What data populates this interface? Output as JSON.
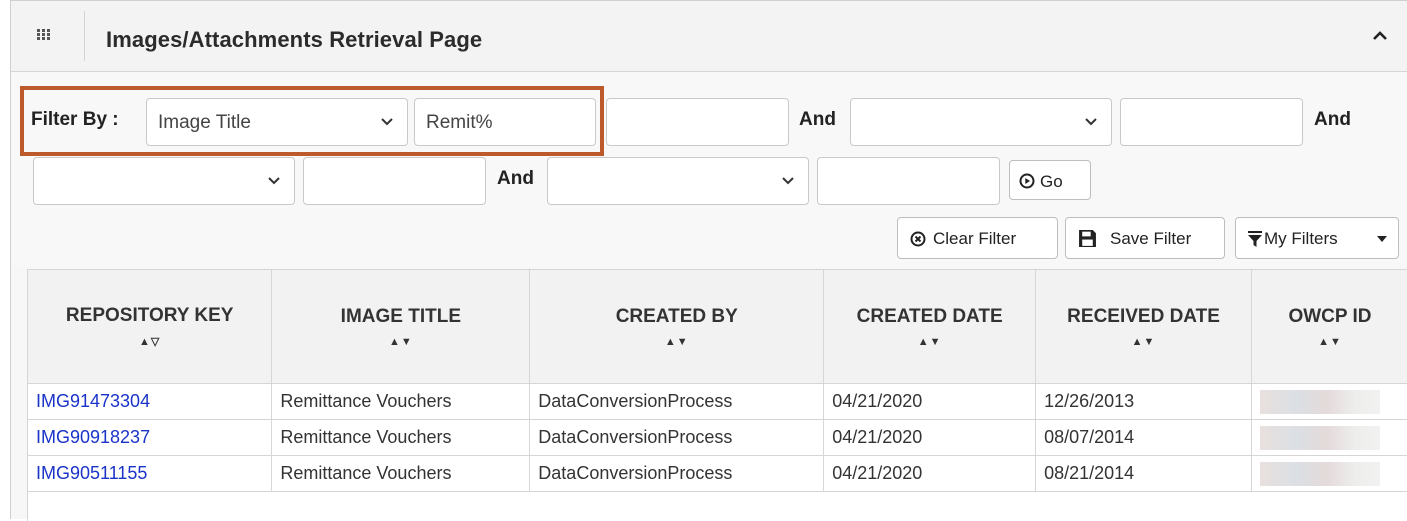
{
  "panel": {
    "title": "Images/Attachments Retrieval Page"
  },
  "filter": {
    "label": "Filter By :",
    "row1": {
      "select1_value": "Image Title",
      "input1_value": "Remit%",
      "input2_value": "",
      "and1": "And",
      "select2_value": "",
      "input3_value": "",
      "and2": "And"
    },
    "row2": {
      "select3_value": "",
      "input4_value": "",
      "and3": "And",
      "select4_value": "",
      "input5_value": "",
      "go_label": "Go"
    },
    "buttons": {
      "clear_label": "Clear Filter",
      "save_label": "Save Filter",
      "my_filters_label": "My Filters"
    }
  },
  "table": {
    "columns": [
      {
        "label": "REPOSITORY KEY",
        "sort": "▲▽"
      },
      {
        "label": "IMAGE TITLE",
        "sort": "▲▼"
      },
      {
        "label": "CREATED BY",
        "sort": "▲▼"
      },
      {
        "label": "CREATED DATE",
        "sort": "▲▼"
      },
      {
        "label": "RECEIVED DATE",
        "sort": "▲▼"
      },
      {
        "label": "OWCP ID",
        "sort": "▲▼"
      }
    ],
    "rows": [
      {
        "repository_key": "IMG91473304",
        "image_title": "Remittance Vouchers",
        "created_by": "DataConversionProcess",
        "created_date": "04/21/2020",
        "received_date": "12/26/2013"
      },
      {
        "repository_key": "IMG90918237",
        "image_title": "Remittance Vouchers",
        "created_by": "DataConversionProcess",
        "created_date": "04/21/2020",
        "received_date": "08/07/2014"
      },
      {
        "repository_key": "IMG90511155",
        "image_title": "Remittance Vouchers",
        "created_by": "DataConversionProcess",
        "created_date": "04/21/2020",
        "received_date": "08/21/2014"
      }
    ]
  },
  "colors": {
    "highlight_border": "#bd5a2c",
    "link": "#1a33c9"
  }
}
